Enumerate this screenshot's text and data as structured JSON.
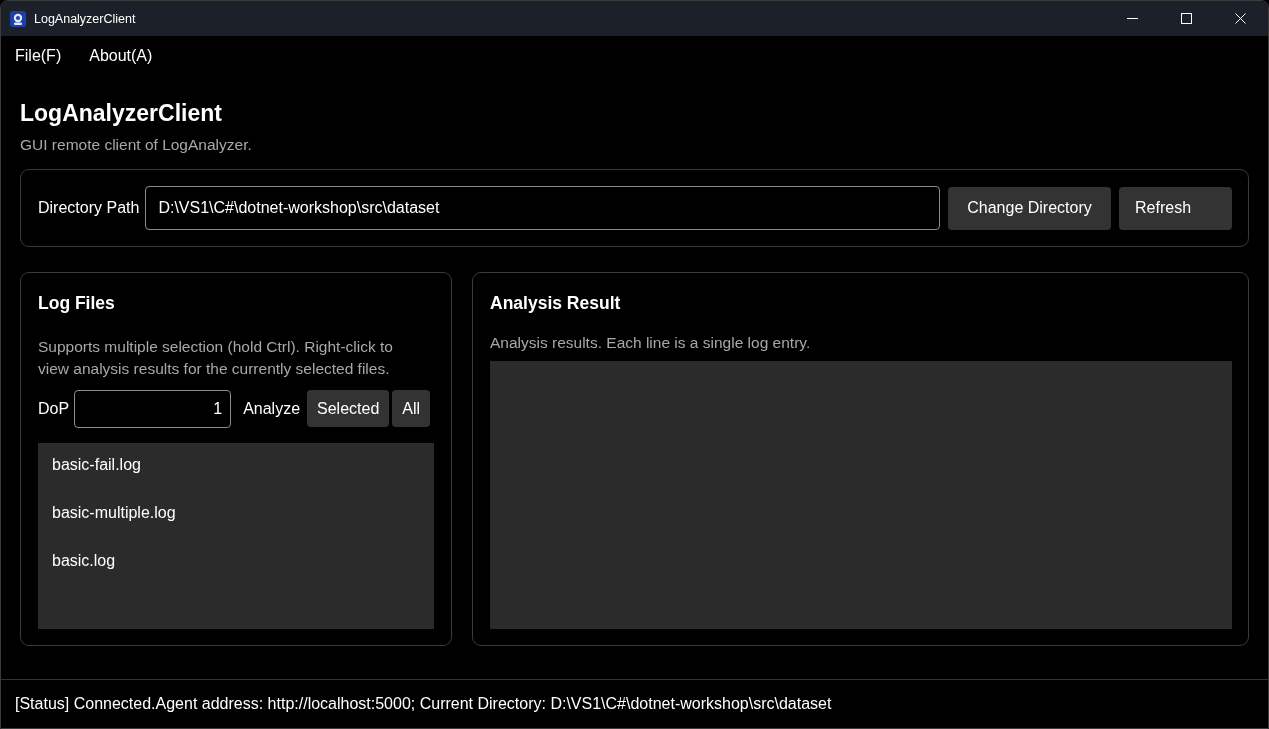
{
  "window": {
    "title": "LogAnalyzerClient"
  },
  "menu": [
    "File(F)",
    "About(A)"
  ],
  "header": {
    "title": "LogAnalyzerClient",
    "subtitle": "GUI remote client of LogAnalyzer."
  },
  "directory": {
    "label": "Directory Path",
    "value": "D:\\VS1\\C#\\dotnet-workshop\\src\\dataset",
    "buttons": [
      "Change Directory",
      "Refresh"
    ]
  },
  "log_files": {
    "title": "Log Files",
    "description": "Supports multiple selection (hold Ctrl). Right-click to view analysis results for the currently selected files.",
    "dop_label": "DoP",
    "dop_value": "1",
    "analyze_label": "Analyze",
    "buttons": [
      "Selected",
      "All"
    ],
    "files": [
      {
        "name": "basic-fail.log",
        "selected": false
      },
      {
        "name": "basic-multiple.log",
        "selected": false
      },
      {
        "name": "basic.log",
        "selected": false
      }
    ]
  },
  "analysis": {
    "title": "Analysis Result",
    "description": "Analysis results. Each line is a single log entry."
  },
  "status_bar": {
    "text": "[Status] Connected.Agent address: http://localhost:5000; Current Directory: D:\\VS1\\C#\\dotnet-workshop\\src\\dataset"
  }
}
